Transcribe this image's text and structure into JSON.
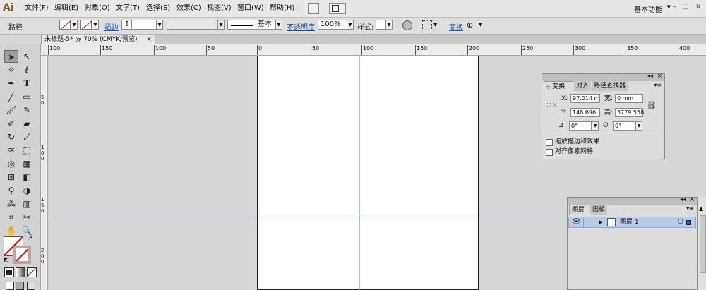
{
  "app": {
    "logo": "Ai"
  },
  "menu": [
    "文件(F)",
    "编辑(E)",
    "对象(O)",
    "文字(T)",
    "选择(S)",
    "效果(C)",
    "视图(V)",
    "窗口(W)",
    "帮助(H)"
  ],
  "workspace": "基本功能",
  "window_controls": {
    "minimize": "–",
    "maximize": "□",
    "close": "×"
  },
  "control_bar": {
    "label": "路径",
    "stroke_link": "描边",
    "stroke_style": "基本",
    "opacity_link": "不透明度",
    "opacity_value": "100%",
    "style_label": "样式:",
    "transform_link": "变换"
  },
  "document_tab": {
    "title": "未标题-5* @ 70% (CMYK/预览)",
    "close": "×"
  },
  "ruler_h_labels": [
    "100",
    "150",
    "100",
    "50",
    "0",
    "50",
    "100",
    "150",
    "200",
    "250",
    "300",
    "350",
    "400"
  ],
  "ruler_v_labels": [
    "5 0",
    "1 0 0",
    "1 5 0",
    "2 0 0"
  ],
  "transform_panel": {
    "tabs": [
      "变换",
      "对齐",
      "路径查找器"
    ],
    "x_label": "X:",
    "x_value": "97.014 m",
    "w_label": "宽:",
    "w_value": "0 mm",
    "y_label": "Y:",
    "y_value": "148.696",
    "h_label": "高:",
    "h_value": "5779.558",
    "rotate_value": "0°",
    "shear_value": "0°",
    "scale_strokes": "缩放描边和效果",
    "align_pixel": "对齐像素网格"
  },
  "layers_panel": {
    "tabs": [
      "图层",
      "画板"
    ],
    "layer_name": "图层 1"
  },
  "colors": {
    "layer_highlight": "#b8cce8",
    "guide": "#7fd6d6",
    "link": "#1a55a8"
  }
}
